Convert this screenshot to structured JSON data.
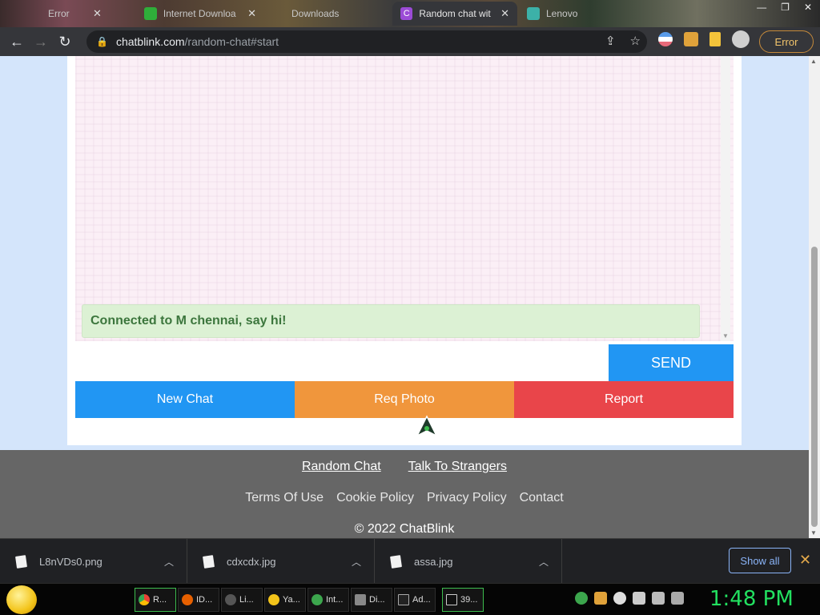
{
  "browser": {
    "tabs": [
      {
        "title": "Error",
        "active": false
      },
      {
        "title": "Internet Downloa",
        "active": false
      },
      {
        "title": "Downloads",
        "active": false
      },
      {
        "title": "Random chat wit",
        "active": true
      },
      {
        "title": "Lenovo",
        "active": false
      }
    ],
    "url_host": "chatblink.com",
    "url_path": "/random-chat#start",
    "profile_status": "Error"
  },
  "chat": {
    "system_message": "Connected to M chennai, say hi!",
    "message_input_value": "",
    "send_label": "SEND",
    "actions": {
      "new_chat": "New Chat",
      "req_photo": "Req Photo",
      "report": "Report"
    }
  },
  "footer": {
    "primary_links": [
      "Random Chat",
      "Talk To Strangers"
    ],
    "secondary_links": [
      "Terms Of Use",
      "Cookie Policy",
      "Privacy Policy",
      "Contact"
    ],
    "copyright": "© 2022 ChatBlink"
  },
  "downloads": {
    "items": [
      "L8nVDs0.png",
      "cdxcdx.jpg",
      "assa.jpg"
    ],
    "show_all_label": "Show all"
  },
  "taskbar": {
    "items": [
      "R...",
      "ID...",
      "Li...",
      "Ya...",
      "Int...",
      "Di...",
      "Ad...",
      "39..."
    ],
    "clock": "1:48 PM"
  },
  "colors": {
    "send": "#2196f3",
    "new_chat": "#2196f3",
    "req_photo": "#f0963c",
    "report": "#e9454a",
    "system_message_bg": "#dcf1d4",
    "footer_bg": "#666666",
    "clock": "#22e060"
  }
}
